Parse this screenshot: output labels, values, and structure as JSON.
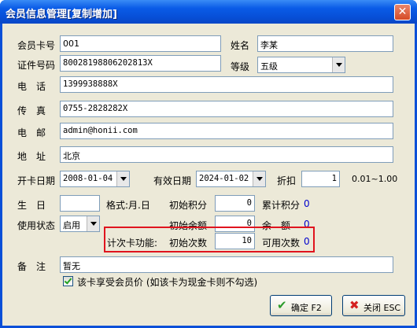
{
  "window": {
    "title": "会员信息管理[复制增加]",
    "close_glyph": "✕"
  },
  "form": {
    "card_no": {
      "label": "会员卡号",
      "value": "001"
    },
    "name": {
      "label": "姓名",
      "value": "李某"
    },
    "id_no": {
      "label": "证件号码",
      "value": "80028198806202813X"
    },
    "level": {
      "label": "等级",
      "value": "五级"
    },
    "phone": {
      "label": "电　话",
      "value": "1399938888X"
    },
    "fax": {
      "label": "传　真",
      "value": "0755-2828282X"
    },
    "email": {
      "label": "电　邮",
      "value": "admin@honii.com"
    },
    "address": {
      "label": "地　址",
      "value": "北京"
    },
    "open_date": {
      "label": "开卡日期",
      "value": "2008-01-04"
    },
    "expire_date": {
      "label": "有效日期",
      "value": "2024-01-02"
    },
    "discount": {
      "label": "折扣",
      "value": "1",
      "range": "0.01~1.00"
    },
    "birthday": {
      "label": "生　日",
      "value": "",
      "format_hint": "格式:月.日"
    },
    "initial_points": {
      "label": "初始积分",
      "value": "0"
    },
    "total_points": {
      "label": "累计积分",
      "value": "0"
    },
    "status": {
      "label": "使用状态",
      "value": "启用"
    },
    "initial_balance": {
      "label": "初始余额",
      "value": "0"
    },
    "balance": {
      "label": "余　额",
      "value": "0"
    },
    "count_card": {
      "label": "计次卡功能:",
      "initial_count_label": "初始次数",
      "initial_count_value": "10",
      "available_label": "可用次数",
      "available_value": "0"
    },
    "remark": {
      "label": "备　注",
      "value": "暂无"
    },
    "member_price": {
      "label": "该卡享受会员价 (如该卡为现金卡则不勾选)",
      "checked": true
    }
  },
  "buttons": {
    "ok": {
      "label": "确定 F2",
      "icon": "check-icon"
    },
    "close": {
      "label": "关闭 ESC",
      "icon": "x-icon"
    }
  },
  "colors": {
    "highlight_box": "#e0141e",
    "value_blue": "#0000cc",
    "title_bar": "#0a5be7"
  }
}
